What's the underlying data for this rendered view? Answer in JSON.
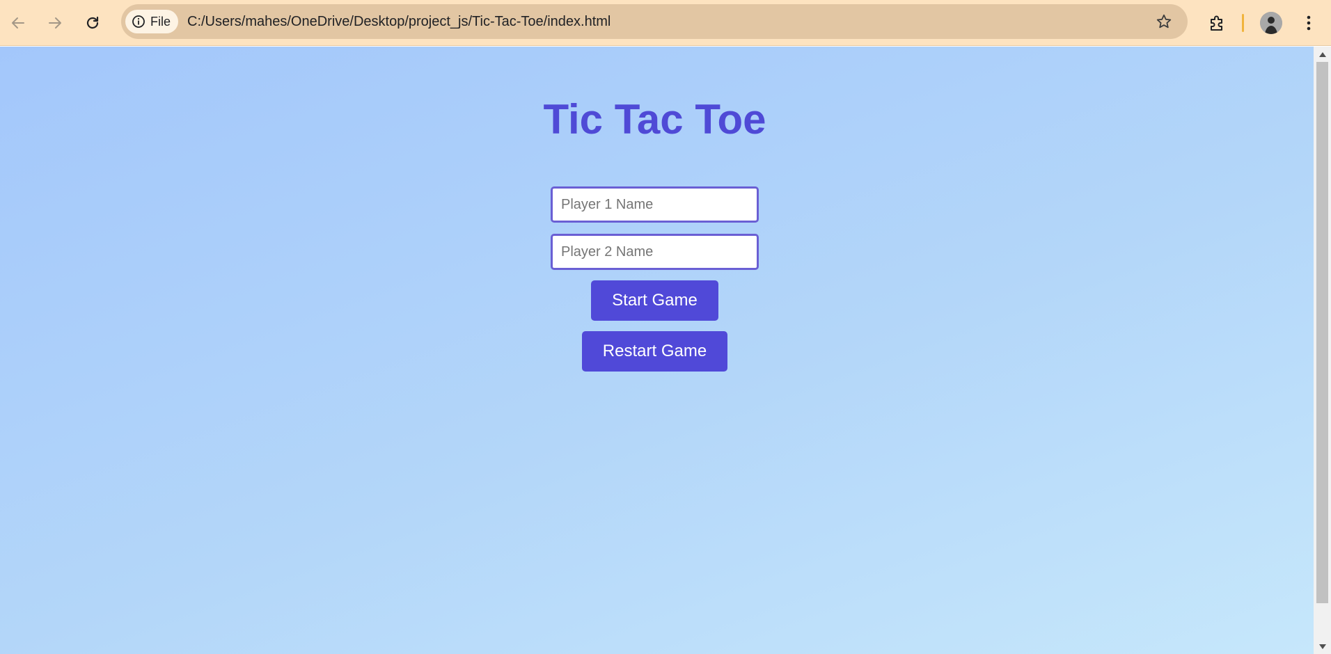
{
  "browser": {
    "back_icon": "arrow-left-icon",
    "forward_icon": "arrow-right-icon",
    "reload_icon": "reload-icon",
    "site_info_icon": "info-icon",
    "site_chip_label": "File",
    "url": "C:/Users/mahes/OneDrive/Desktop/project_js/Tic-Tac-Toe/index.html",
    "bookmark_icon": "star-icon",
    "extensions_icon": "puzzle-icon",
    "profile_icon": "avatar",
    "menu_icon": "kebab-menu-icon",
    "toolbar_color": "#fde3c0",
    "omnibox_color": "#e2c6a3"
  },
  "page": {
    "title": "Tic Tac Toe",
    "player1": {
      "placeholder": "Player 1 Name",
      "value": ""
    },
    "player2": {
      "placeholder": "Player 2 Name",
      "value": ""
    },
    "start_label": "Start Game",
    "restart_label": "Restart Game",
    "accent_color": "#5049d8",
    "title_color": "#4f4ad6"
  }
}
